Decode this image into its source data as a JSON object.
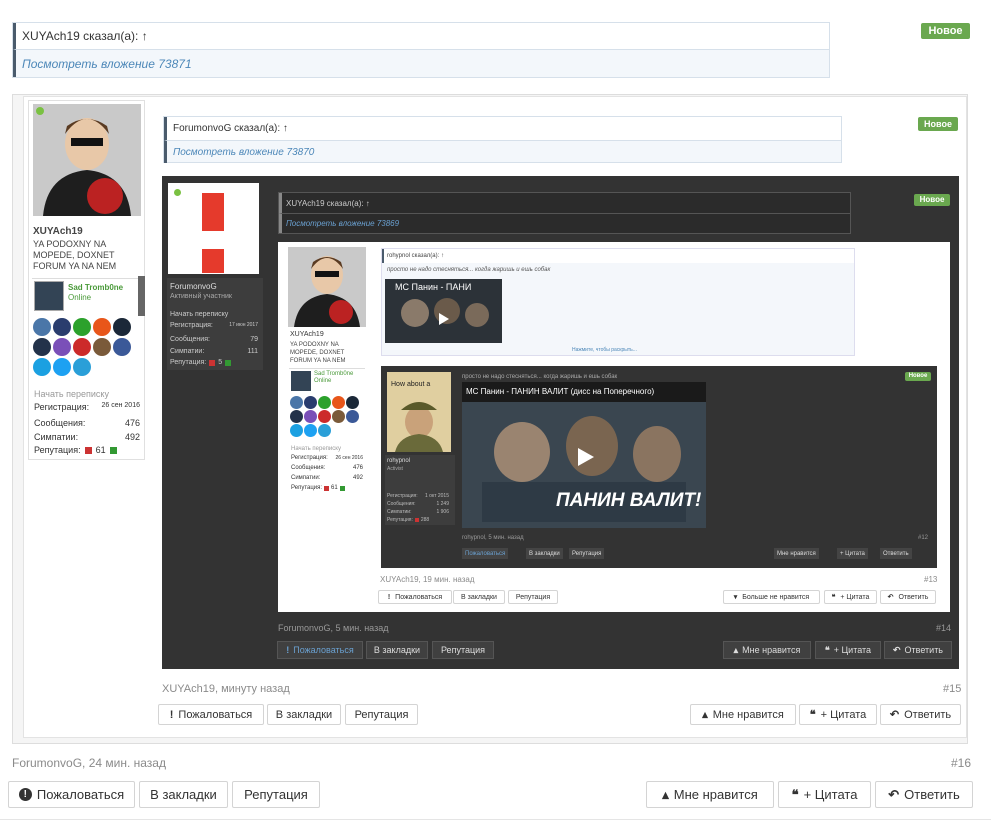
{
  "top_quote": {
    "author": "XUYAch19 сказал(а): ↑",
    "attachment": "Посмотреть вложение 73871"
  },
  "badge_new": "Новое",
  "post15": {
    "user": {
      "name": "XUYAch19",
      "title": "YA PODOXNY NA MOPEDE, DOXNET FORUM YA NA NEM",
      "friend_name": "Sad Tromb0ne",
      "friend_status": "Online",
      "start_conv": "Начать переписку",
      "stats": [
        {
          "label": "Регистрация:",
          "value": "26 сен 2016"
        },
        {
          "label": "Сообщения:",
          "value": "476"
        },
        {
          "label": "Симпатии:",
          "value": "492"
        },
        {
          "label": "Репутация:",
          "value": "61"
        }
      ]
    },
    "quote": {
      "author": "ForumonvoG сказал(а): ↑",
      "attachment": "Посмотреть вложение 73870"
    },
    "meta_author": "XUYAch19, минуту назад",
    "num": "#15"
  },
  "post14": {
    "user": {
      "name": "ForumonvoG",
      "title": "Активный участник",
      "start_conv": "Начать переписку",
      "stats": [
        {
          "label": "Регистрация:",
          "value": "17 июн 2017"
        },
        {
          "label": "Сообщения:",
          "value": "79"
        },
        {
          "label": "Симпатии:",
          "value": "111"
        },
        {
          "label": "Репутация:",
          "value": "5"
        }
      ]
    },
    "quote": {
      "author": "XUYAch19 сказал(а): ↑",
      "attachment": "Посмотреть вложение 73869"
    },
    "meta_author": "ForumonvoG, 5 мин. назад",
    "num": "#14"
  },
  "post13": {
    "quote": {
      "author": "rohypnol сказал(а): ↑",
      "text": "просто не надо стесняться... когда жаришь и ешь собак",
      "video": "МС Панин - ПАНИ",
      "expand": "Нажмите, чтобы раскрыть..."
    },
    "user": {
      "name": "XUYAch19",
      "title": "YA PODOXNY NA MOPEDE, DOXNET FORUM YA NA NEM",
      "friend_name": "Sad Tromb0ne",
      "friend_status": "Online",
      "start_conv": "Начать переписку",
      "stats": [
        {
          "label": "Регистрация:",
          "value": "26 сен 2016"
        },
        {
          "label": "Сообщения:",
          "value": "476"
        },
        {
          "label": "Симпатии:",
          "value": "492"
        },
        {
          "label": "Репутация:",
          "value": "61"
        }
      ]
    },
    "meta_author": "XUYAch19, 19 мин. назад",
    "num": "#13"
  },
  "post12": {
    "text": "просто не надо стесняться... когда жаришь и ешь собак",
    "video_title": "МС Панин - ПАНИН ВАЛИТ (дисс на Поперечного)",
    "video_overlay": "ПАНИН ВАЛИТ!",
    "user": {
      "name": "rohypnol",
      "title": "Activist",
      "stats": [
        {
          "label": "Регистрация:",
          "value": "1 окт 2015"
        },
        {
          "label": "Сообщения:",
          "value": "1 249"
        },
        {
          "label": "Симпатии:",
          "value": "1 906"
        },
        {
          "label": "Репутация:",
          "value": "288"
        }
      ]
    },
    "meta_author": "rohypnol, 5 мин. назад",
    "num": "#12"
  },
  "post16": {
    "meta_author": "ForumonvoG, 24 мин. назад",
    "num": "#16"
  },
  "actions": {
    "report": "Пожаловаться",
    "bookmark": "В закладки",
    "reputation": "Репутация",
    "like": "Мне нравится",
    "dislike": "Больше не нравится",
    "quote": "+ Цитата",
    "reply": "Ответить"
  },
  "colors": {
    "accent": "#4c87b8",
    "new_badge": "#6aa84f",
    "dark_bg": "#333333"
  }
}
